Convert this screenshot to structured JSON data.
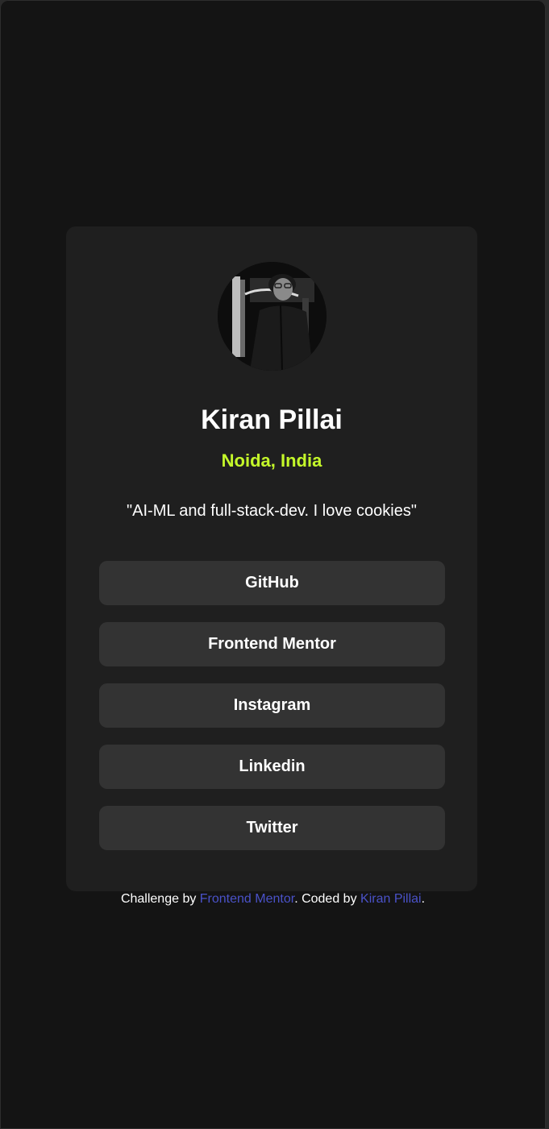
{
  "profile": {
    "avatar_icon": "profile-photo",
    "name": "Kiran Pillai",
    "location": "Noida, India",
    "bio": "\"AI-ML and full-stack-dev. I love cookies\""
  },
  "links": [
    {
      "label": "GitHub"
    },
    {
      "label": "Frontend Mentor"
    },
    {
      "label": "Instagram"
    },
    {
      "label": "Linkedin"
    },
    {
      "label": "Twitter"
    }
  ],
  "attribution": {
    "prefix": "Challenge by ",
    "challenge_link": "Frontend Mentor",
    "middle": ". Coded by ",
    "author_link": "Kiran Pillai",
    "suffix": "."
  },
  "colors": {
    "page_background": "#141414",
    "card_background": "#1f1f1f",
    "button_background": "#333333",
    "accent": "#c4f82a",
    "link": "#4a52c9",
    "text": "#ffffff"
  }
}
